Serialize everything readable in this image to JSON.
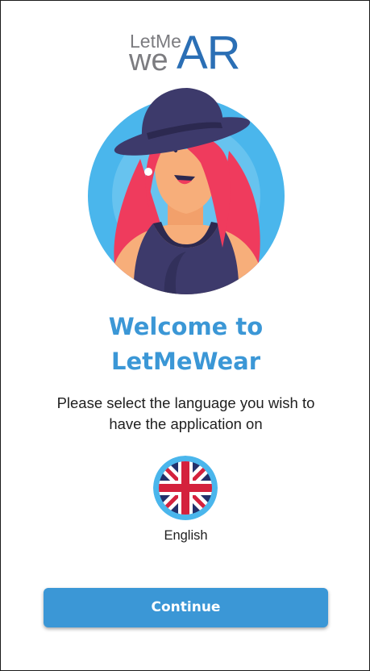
{
  "logo": {
    "line1": "LetMe",
    "line2_we": "we",
    "line2_ar": "AR"
  },
  "welcome": {
    "line1": "Welcome to",
    "line2": "LetMeWear"
  },
  "instruction": {
    "line1": "Please select the language you wish to",
    "line2": "have the application on"
  },
  "language": {
    "flag_icon": "uk-flag-icon",
    "label": "English"
  },
  "continue_button": {
    "label": "Continue"
  },
  "colors": {
    "accent": "#3b97d6",
    "logo_gray": "#7c7c80",
    "logo_blue": "#2b6fb5",
    "avatar_bg": "#4ab6ec",
    "hat": "#3d3a6b",
    "hair": "#ef3b5d"
  }
}
